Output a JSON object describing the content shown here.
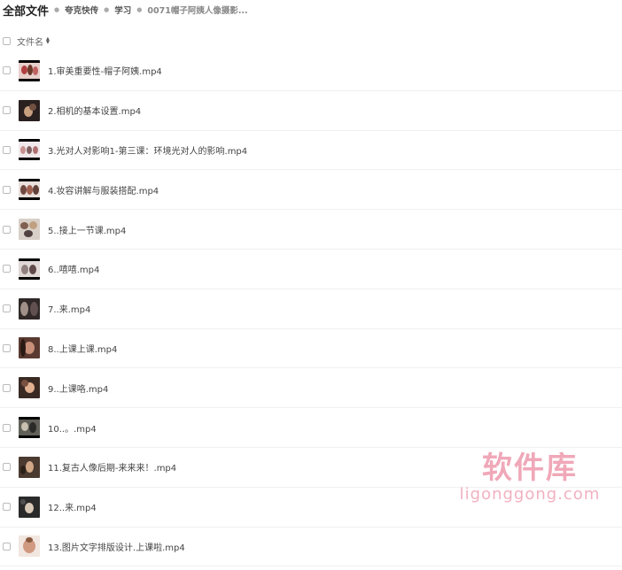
{
  "breadcrumb": {
    "root": "全部文件",
    "items": [
      "夸克快传",
      "学习",
      "0071帽子阿姨人像摄影..."
    ]
  },
  "list_header": {
    "name_label": "文件名",
    "sort_icon": "sort-icon"
  },
  "files": [
    {
      "name": "1.审美重要性-帽子阿姨.mp4",
      "thumb": "video-thumbnail"
    },
    {
      "name": "2.相机的基本设置.mp4",
      "thumb": "video-thumbnail"
    },
    {
      "name": "3.光对人对影响1-第三课：环境光对人的影响.mp4",
      "thumb": "video-thumbnail"
    },
    {
      "name": "4.妆容讲解与服装搭配.mp4",
      "thumb": "video-thumbnail"
    },
    {
      "name": "5..接上一节课.mp4",
      "thumb": "video-thumbnail"
    },
    {
      "name": "6..嘻嘻.mp4",
      "thumb": "video-thumbnail"
    },
    {
      "name": "7..来.mp4",
      "thumb": "video-thumbnail"
    },
    {
      "name": "8..上课上课.mp4",
      "thumb": "video-thumbnail"
    },
    {
      "name": "9..上课咯.mp4",
      "thumb": "video-thumbnail"
    },
    {
      "name": "10..。.mp4",
      "thumb": "video-thumbnail"
    },
    {
      "name": "11.复古人像后期-来来来！.mp4",
      "thumb": "video-thumbnail"
    },
    {
      "name": "12..来.mp4",
      "thumb": "video-thumbnail"
    },
    {
      "name": "13.图片文字排版设计.上课啦.mp4",
      "thumb": "video-thumbnail"
    }
  ],
  "watermark": {
    "title": "软件库",
    "url": "ligonggong.com"
  },
  "colors": {
    "watermark": "#f0a8b8",
    "text": "#444444",
    "divider": "#f0f0f0"
  }
}
